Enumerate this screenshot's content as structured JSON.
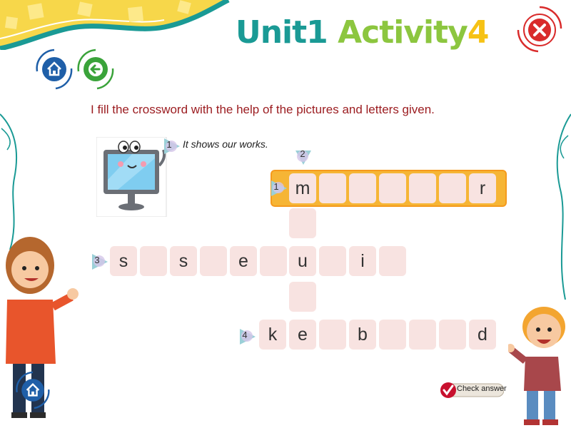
{
  "header": {
    "title_unit": "Unit",
    "title_unit_num": "1",
    "title_activity": "Activity",
    "title_activity_num": "4"
  },
  "nav": {
    "home_icon": "home-icon",
    "back_icon": "back-arrow-icon",
    "close_icon": "close-icon"
  },
  "instruction": "I fill the crossword with the help of the pictures and letters given.",
  "clue": {
    "number": "1",
    "text": "It shows our works.",
    "picture": "computer-monitor-picture"
  },
  "crossword": {
    "badges": [
      "1",
      "2",
      "3",
      "4"
    ],
    "row1": [
      "m",
      "",
      "",
      "",
      "",
      "",
      "r"
    ],
    "column2": [
      "",
      "",
      ""
    ],
    "row3": [
      "s",
      "",
      "s",
      "",
      "e",
      "",
      "u",
      "",
      "i",
      ""
    ],
    "row4": [
      "k",
      "e",
      "",
      "b",
      "",
      "",
      "",
      "d"
    ]
  },
  "check_button": {
    "label": "Check answer"
  },
  "colors": {
    "teal": "#1a9a95",
    "green": "#8cc63f",
    "yellow": "#f6c215",
    "red": "#d92b2b",
    "cell": "#f8e3e1",
    "highlight": "#f6b535",
    "instruction": "#9b1b1f"
  }
}
